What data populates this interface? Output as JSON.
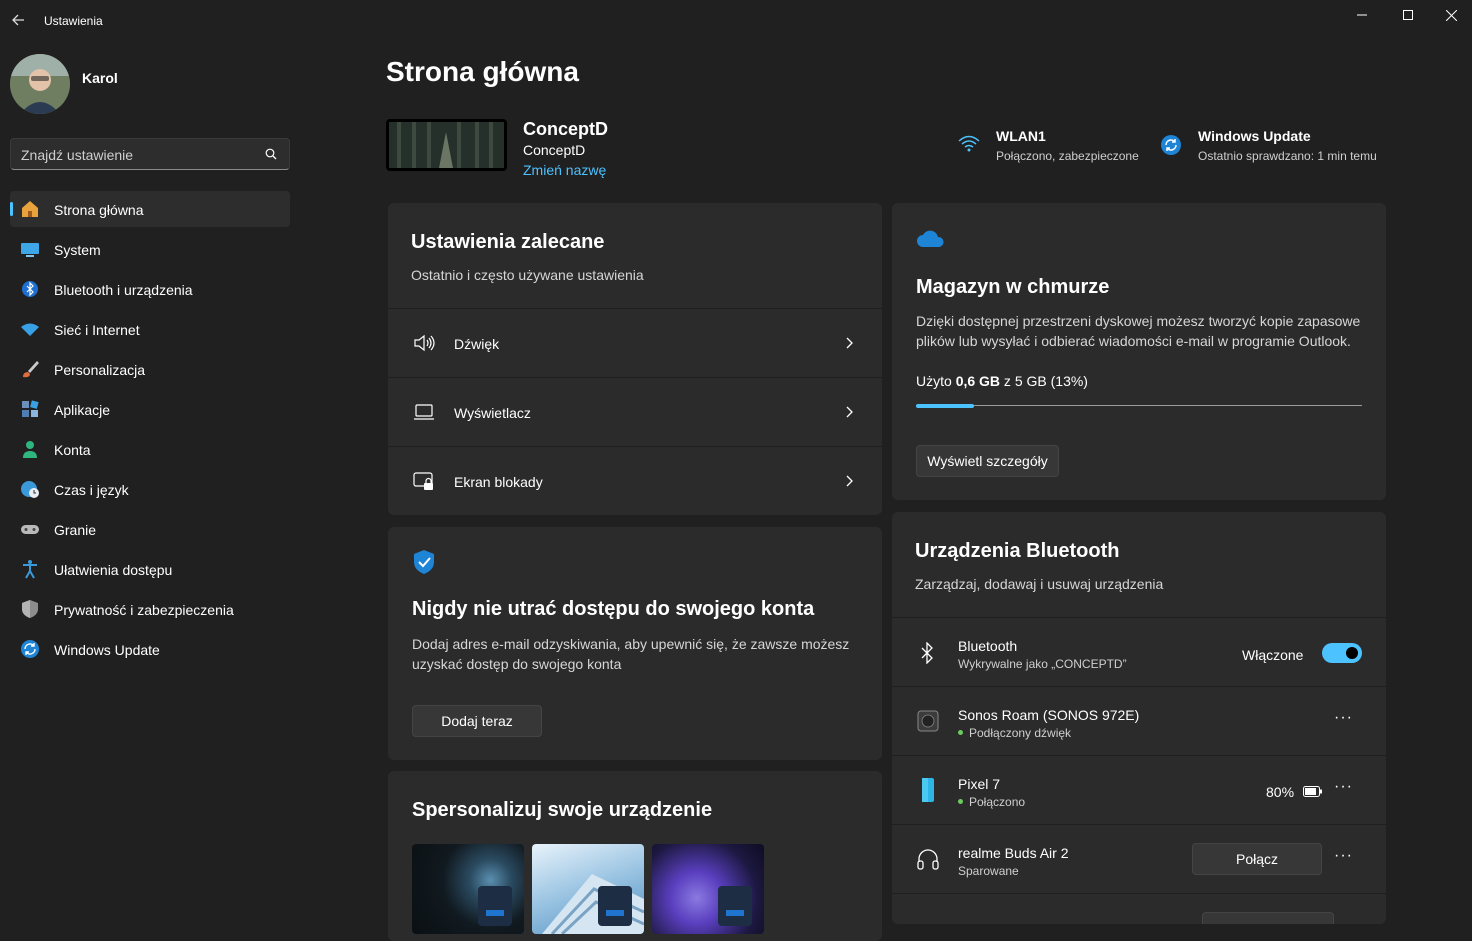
{
  "window": {
    "title": "Ustawienia"
  },
  "user": {
    "name": "Karol"
  },
  "search": {
    "placeholder": "Znajdź ustawienie"
  },
  "nav": [
    {
      "label": "Strona główna",
      "icon": "home-icon",
      "active": true
    },
    {
      "label": "System",
      "icon": "monitor-icon"
    },
    {
      "label": "Bluetooth i urządzenia",
      "icon": "bluetooth-icon"
    },
    {
      "label": "Sieć i Internet",
      "icon": "wifi-icon"
    },
    {
      "label": "Personalizacja",
      "icon": "brush-icon"
    },
    {
      "label": "Aplikacje",
      "icon": "apps-icon"
    },
    {
      "label": "Konta",
      "icon": "person-icon"
    },
    {
      "label": "Czas i język",
      "icon": "globe-clock-icon"
    },
    {
      "label": "Granie",
      "icon": "gamepad-icon"
    },
    {
      "label": "Ułatwienia dostępu",
      "icon": "accessibility-icon"
    },
    {
      "label": "Prywatność i zabezpieczenia",
      "icon": "shield-icon"
    },
    {
      "label": "Windows Update",
      "icon": "sync-icon"
    }
  ],
  "page": {
    "title": "Strona główna"
  },
  "device": {
    "name": "ConceptD",
    "model": "ConceptD",
    "rename_link": "Zmień nazwę"
  },
  "status": {
    "wifi": {
      "title": "WLAN1",
      "sub": "Połączono, zabezpieczone"
    },
    "update": {
      "title": "Windows Update",
      "sub": "Ostatnio sprawdzano: 1 min temu"
    }
  },
  "recommended": {
    "title": "Ustawienia zalecane",
    "subtitle": "Ostatnio i często używane ustawienia",
    "items": [
      {
        "label": "Dźwięk",
        "icon": "speaker-icon"
      },
      {
        "label": "Wyświetlacz",
        "icon": "laptop-icon"
      },
      {
        "label": "Ekran blokady",
        "icon": "lock-screen-icon"
      }
    ]
  },
  "account": {
    "title": "Nigdy nie utrać dostępu do swojego konta",
    "text_line1": "Dodaj adres e-mail odzyskiwania, aby upewnić się, że zawsze możesz",
    "text_line2": "uzyskać dostęp do swojego konta",
    "button": "Dodaj teraz"
  },
  "personalize": {
    "title": "Spersonalizuj swoje urządzenie"
  },
  "cloud": {
    "title": "Magazyn w chmurze",
    "text_line1": "Dzięki dostępnej przestrzeni dyskowej możesz tworzyć kopie zapasowe",
    "text_line2": "plików lub wysyłać i odbierać wiadomości e-mail w programie Outlook.",
    "used_prefix": "Użyto ",
    "used_value": "0,6 GB",
    "used_suffix": " z 5 GB (13%)",
    "used_fraction": 0.13,
    "button": "Wyświetl szczegóły"
  },
  "bluetooth": {
    "title": "Urządzenia Bluetooth",
    "subtitle": "Zarządzaj, dodawaj i usuwaj urządzenia",
    "toggle_row": {
      "title": "Bluetooth",
      "sub": "Wykrywalne jako „CONCEPTD”",
      "state_label": "Włączone"
    },
    "devices": [
      {
        "name": "Sonos Roam (SONOS 972E)",
        "status": "Podłączony dźwięk",
        "icon": "speaker-device-icon"
      },
      {
        "name": "Pixel 7",
        "status": "Połączono",
        "battery": "80%",
        "icon": "phone-icon"
      },
      {
        "name": "realme Buds Air 2",
        "status": "Sparowane",
        "button": "Połącz",
        "icon": "headphones-icon"
      }
    ],
    "more_glyph": "···"
  },
  "colors": {
    "accent": "#4cc2ff",
    "background": "#202020",
    "card": "#2b2b2b",
    "online": "#6ccb5f"
  }
}
